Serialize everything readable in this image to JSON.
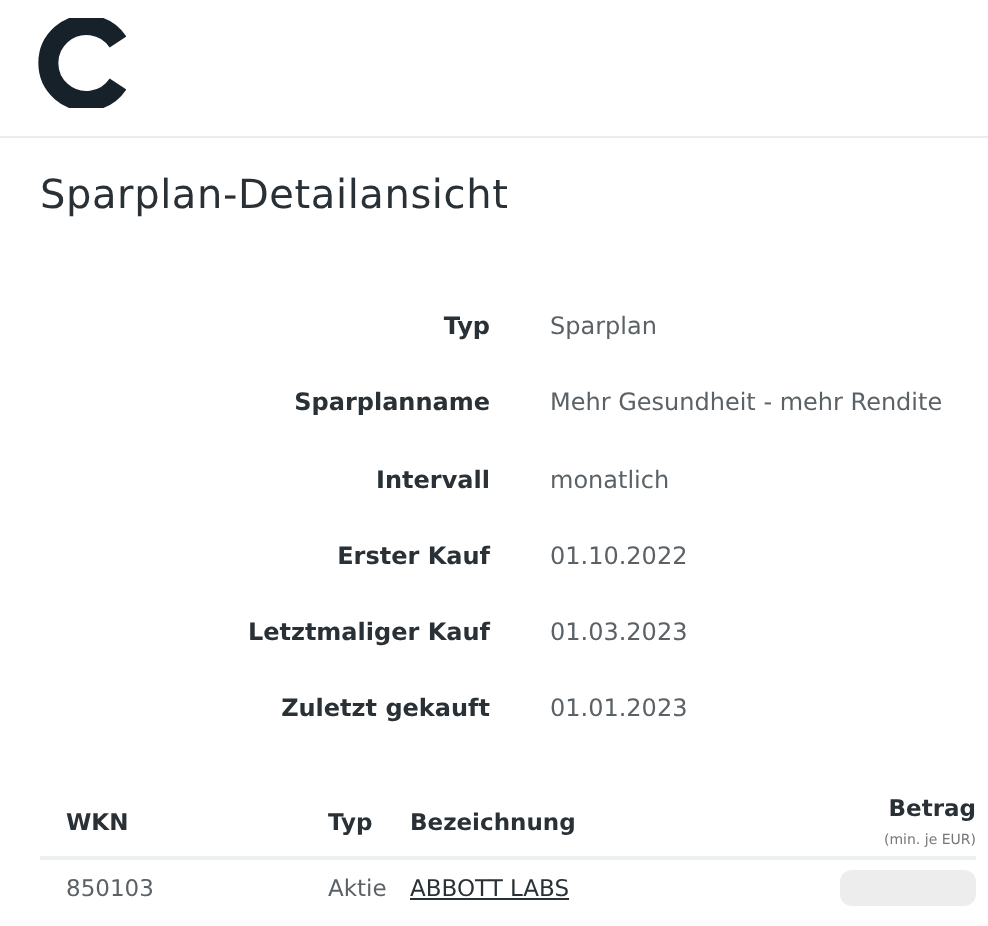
{
  "page": {
    "title": "Sparplan-Detailansicht"
  },
  "details": [
    {
      "label": "Typ",
      "value": "Sparplan"
    },
    {
      "label": "Sparplanname",
      "value": "Mehr Gesundheit - mehr Rendite"
    },
    {
      "label": "Intervall",
      "value": "monatlich"
    },
    {
      "label": "Erster Kauf",
      "value": "01.10.2022"
    },
    {
      "label": "Letztmaliger Kauf",
      "value": "01.03.2023"
    },
    {
      "label": "Zuletzt gekauft",
      "value": "01.01.2023"
    }
  ],
  "table": {
    "columns": [
      {
        "label": "WKN"
      },
      {
        "label": "Typ"
      },
      {
        "label": "Bezeichnung"
      },
      {
        "label": "Betrag",
        "note": "(min. je EUR)"
      }
    ],
    "rows": [
      {
        "wkn": "850103",
        "type": "Aktie",
        "name": "ABBOTT LABS",
        "amount_hidden": true
      }
    ]
  }
}
